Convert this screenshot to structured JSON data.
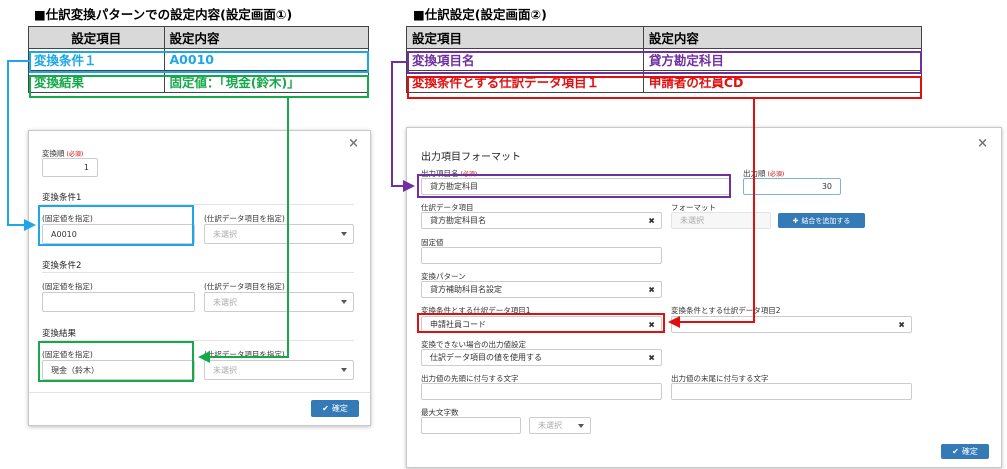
{
  "left": {
    "heading": "■仕訳変換パターンでの設定内容(設定画面①)",
    "table": {
      "headers": [
        "設定項目",
        "設定内容"
      ],
      "rows": [
        [
          "変換条件１",
          "A0010"
        ],
        [
          "変換結果",
          "固定値：「現金(鈴木)」"
        ]
      ]
    },
    "dialog": {
      "close": "×",
      "order_label": "変換順",
      "required": "(必須)",
      "order_value": "1",
      "cond1_title": "変換条件1",
      "cond2_title": "変換条件2",
      "result_title": "変換結果",
      "fixed_label": "(固定値を指定)",
      "field_label": "(仕訳データ項目を指定)",
      "cond1_fixed_value": "A0010",
      "unselected": "未選択",
      "result_fixed_value": "現金（鈴木）",
      "confirm": "確定"
    }
  },
  "right": {
    "heading": "■仕訳設定(設定画面②)",
    "table": {
      "headers": [
        "設定項目",
        "設定内容"
      ],
      "rows": [
        [
          "変換項目名",
          "貸方勘定科目"
        ],
        [
          "変換条件とする仕訳データ項目１",
          "申請者の社員CD"
        ]
      ]
    },
    "dialog": {
      "close": "×",
      "title": "出力項目フォーマット",
      "required": "(必須)",
      "output_name_label": "出力項目名",
      "output_name_value": "貸方勘定科目",
      "output_order_label": "出力順",
      "output_order_value": "30",
      "journal_item_label": "仕訳データ項目",
      "journal_item_value": "貸方勘定科目名",
      "format_label": "フォーマット",
      "format_value": "未選択",
      "add_join_button": "結合を追加する",
      "fixed_label": "固定値",
      "pattern_label": "変換パターン",
      "pattern_value": "貸方補助科目名設定",
      "cond1_label": "変換条件とする仕訳データ項目1",
      "cond1_value": "申請社員コード",
      "cond2_label": "変換条件とする仕訳データ項目2",
      "fallback_label": "変換できない場合の出力値設定",
      "fallback_value": "仕訳データ項目の値を使用する",
      "prefix_label": "出力値の先頭に付与する文字",
      "suffix_label": "出力値の末尾に付与する文字",
      "maxlen_label": "最大文字数",
      "maxlen_unit": "未選択",
      "confirm": "確定"
    }
  },
  "colors": {
    "blue": "#1da7e8",
    "green": "#17a84b",
    "purple": "#7030a0",
    "red": "#e01010",
    "table_header": "#d9d9d9",
    "button": "#337ab7"
  }
}
